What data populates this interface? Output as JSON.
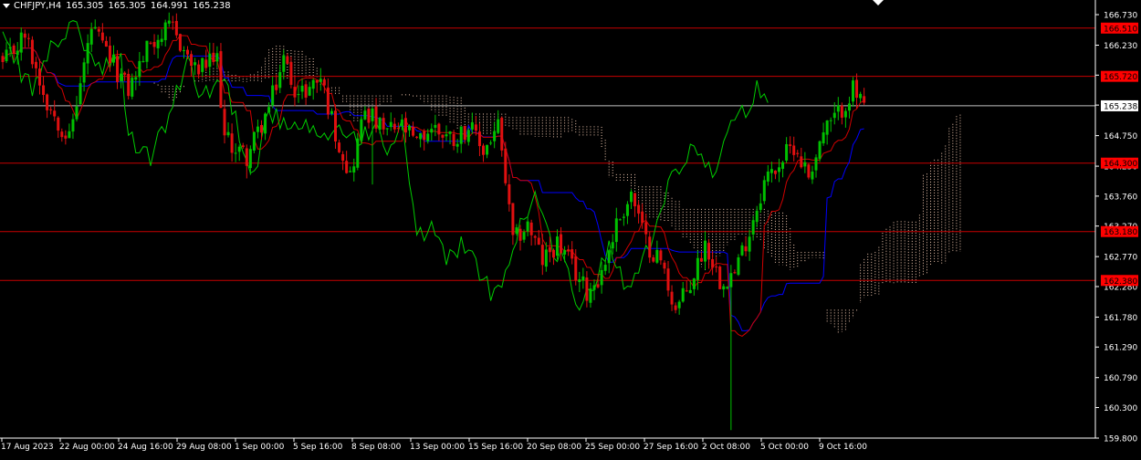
{
  "header": {
    "symbol": "CHFJPY,H4",
    "open": "165.305",
    "high": "165.305",
    "low": "164.991",
    "close": "165.238"
  },
  "colors": {
    "background": "#000000",
    "foreground": "#ffffff",
    "bull_candle": "#00c000",
    "bear_candle": "#e01010",
    "tenkan": "#d00000",
    "kijun": "#0000ff",
    "chikou": "#00cc00",
    "cloud": "#f0c8b0",
    "level_line": "#c80000",
    "level_label_bg": "#ff0000"
  },
  "chart_data": {
    "type": "candlestick",
    "symbol": "CHFJPY",
    "timeframe": "H4",
    "ylim": [
      159.8,
      166.88
    ],
    "y_ticks": [
      "166.730",
      "166.230",
      "165.740",
      "165.250",
      "164.750",
      "164.250",
      "163.760",
      "163.270",
      "162.770",
      "162.280",
      "161.780",
      "161.290",
      "160.790",
      "160.300",
      "159.800"
    ],
    "x_labels": [
      "17 Aug 2023",
      "22 Aug 00:00",
      "24 Aug 16:00",
      "29 Aug 08:00",
      "1 Sep 00:00",
      "5 Sep 16:00",
      "8 Sep 08:00",
      "13 Sep 00:00",
      "15 Sep 16:00",
      "20 Sep 08:00",
      "25 Sep 00:00",
      "27 Sep 16:00",
      "2 Oct 08:00",
      "5 Oct 00:00",
      "9 Oct 16:00"
    ],
    "horizontal_levels": [
      {
        "price": 166.51,
        "label": "166.510"
      },
      {
        "price": 165.72,
        "label": "165.720"
      },
      {
        "price": 164.3,
        "label": "164.300"
      },
      {
        "price": 163.18,
        "label": "163.180"
      },
      {
        "price": 162.38,
        "label": "162.380"
      }
    ],
    "current_price": {
      "price": 165.238,
      "label": "165.238"
    },
    "close_path": [
      [
        0,
        165.9
      ],
      [
        6,
        166.4
      ],
      [
        12,
        165.3
      ],
      [
        18,
        164.7
      ],
      [
        24,
        166.5
      ],
      [
        28,
        166.1
      ],
      [
        34,
        165.5
      ],
      [
        40,
        166.3
      ],
      [
        46,
        166.5
      ],
      [
        52,
        165.8
      ],
      [
        58,
        166.0
      ],
      [
        60,
        164.7
      ],
      [
        66,
        164.4
      ],
      [
        72,
        165.2
      ],
      [
        76,
        166.0
      ],
      [
        80,
        165.4
      ],
      [
        86,
        165.7
      ],
      [
        90,
        164.8
      ],
      [
        94,
        164.1
      ],
      [
        98,
        165.2
      ],
      [
        103,
        164.8
      ],
      [
        108,
        164.9
      ],
      [
        112,
        164.6
      ],
      [
        116,
        164.9
      ],
      [
        122,
        164.7
      ],
      [
        126,
        164.9
      ],
      [
        130,
        164.5
      ],
      [
        134,
        164.9
      ],
      [
        136,
        164.0
      ],
      [
        138,
        163.0
      ],
      [
        142,
        163.3
      ],
      [
        146,
        162.7
      ],
      [
        150,
        163.0
      ],
      [
        154,
        162.6
      ],
      [
        158,
        162.2
      ],
      [
        162,
        162.5
      ],
      [
        166,
        163.3
      ],
      [
        170,
        163.8
      ],
      [
        174,
        163.0
      ],
      [
        178,
        162.7
      ],
      [
        182,
        161.9
      ],
      [
        186,
        162.3
      ],
      [
        190,
        163.0
      ],
      [
        194,
        162.4
      ],
      [
        198,
        162.5
      ],
      [
        202,
        163.2
      ],
      [
        206,
        164.0
      ],
      [
        210,
        164.3
      ],
      [
        214,
        164.6
      ],
      [
        218,
        164.1
      ],
      [
        222,
        164.8
      ],
      [
        226,
        165.1
      ],
      [
        230,
        165.5
      ],
      [
        233,
        165.24
      ]
    ],
    "candle_count": 234
  }
}
